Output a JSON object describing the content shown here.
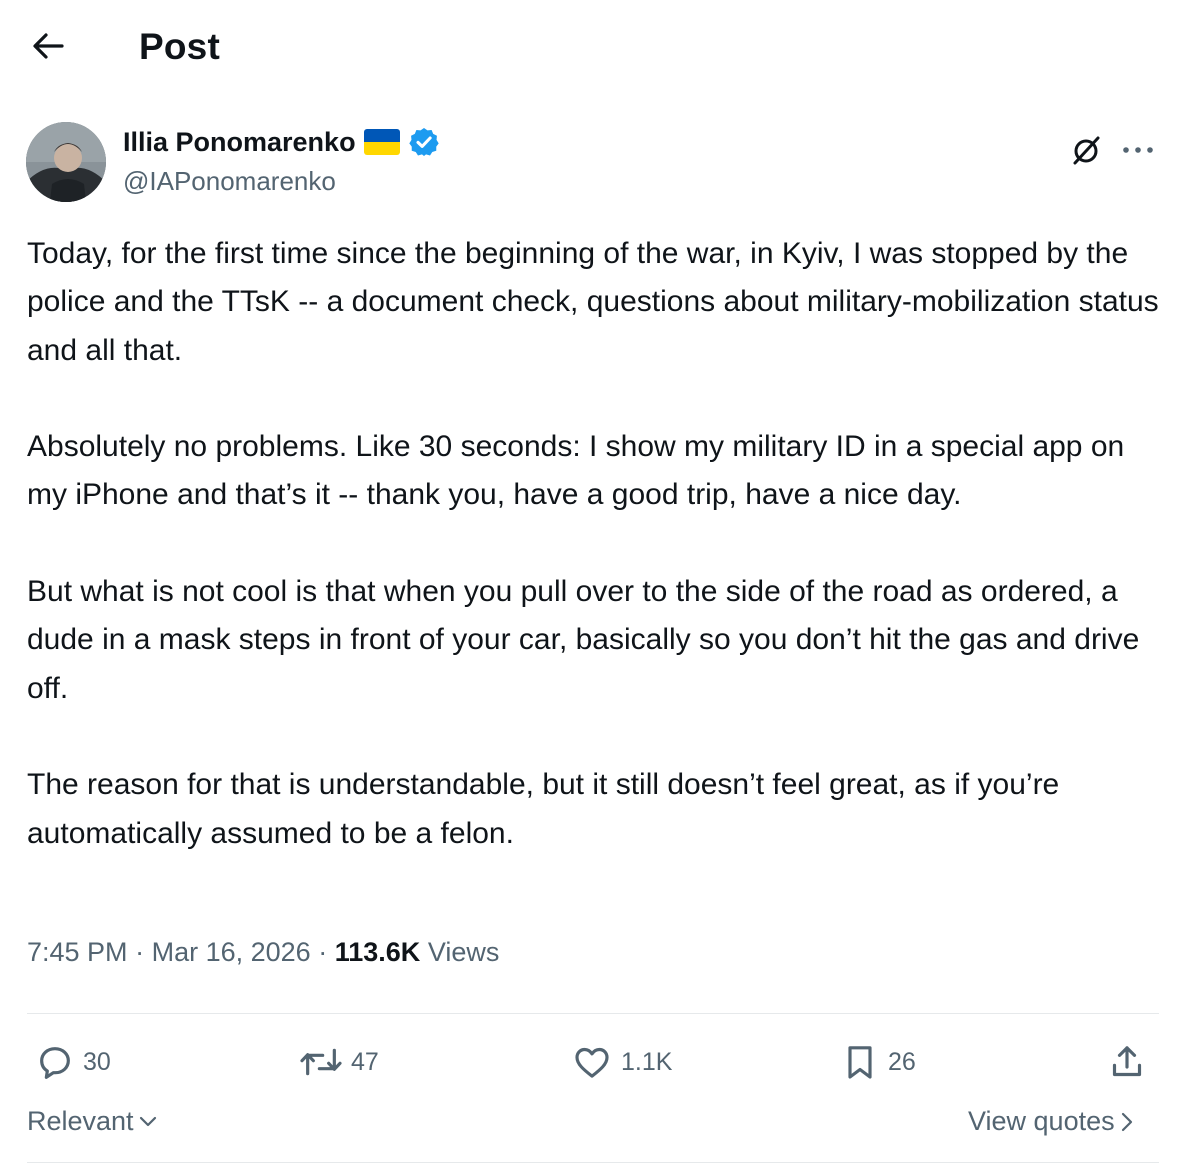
{
  "header": {
    "title": "Post",
    "back_icon": "arrow-left-icon"
  },
  "author": {
    "display_name": "Illia Ponomarenko",
    "handle": "@IAPonomarenko",
    "flag": "ukraine-flag",
    "verified_icon": "verified-badge-icon",
    "verified_color": "#1d9bf0"
  },
  "post": {
    "paragraphs": [
      "Today, for the first time since the beginning of the war, in Kyiv, I was stopped by the police and the TTsK -- a document check, questions about military-mobilization status and all that.",
      "Absolutely no problems. Like 30 seconds: I show my military ID in a special app on my iPhone and that’s it -- thank you, have a good trip, have a nice day.",
      "But what is not cool is that when you pull over to the side of the road as ordered, a dude in a mask steps in front of your car, basically so you don’t hit the gas and drive off.",
      "The reason for that is understandable, but it still doesn’t feel great, as if you’re automatically assumed to be a felon."
    ],
    "time": "7:45 PM",
    "separator": "·",
    "date": "Mar 16, 2026",
    "views_count": "113.6K",
    "views_label": "Views"
  },
  "actions": {
    "replies": "30",
    "reposts": "47",
    "likes": "1.1K",
    "bookmarks": "26"
  },
  "footer": {
    "sort_label": "Relevant",
    "quotes_label": "View quotes"
  },
  "colors": {
    "text": "#0f1419",
    "secondary": "#536471",
    "accent": "#1d9bf0",
    "flag_blue": "#0057b7",
    "flag_yellow": "#ffd700"
  }
}
